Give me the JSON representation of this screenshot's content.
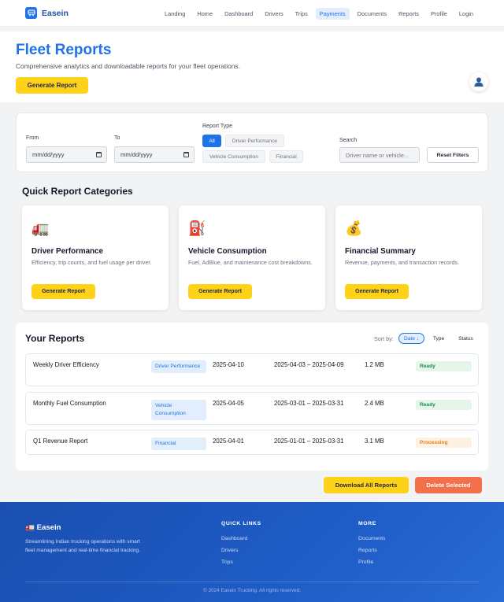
{
  "nav": {
    "brand": "Easein",
    "links": [
      "Landing",
      "Home",
      "Dashboard",
      "Drivers",
      "Trips",
      "Payments",
      "Documents",
      "Reports",
      "Profile",
      "Login"
    ],
    "active": "Payments"
  },
  "hero": {
    "title": "Fleet Reports",
    "subtitle": "Comprehensive analytics and downloadable reports for your fleet operations.",
    "button": "Generate Report"
  },
  "filters": {
    "from_label": "From",
    "to_label": "To",
    "date_placeholder": "mm/dd/yyyy",
    "report_type_label": "Report Type",
    "types": [
      "All",
      "Driver Performance",
      "Vehicle Consumption",
      "Financial"
    ],
    "selected_type": "All",
    "search_label": "Search",
    "search_placeholder": "Driver name or vehicle...",
    "reset_button": "Reset Filters"
  },
  "quick": {
    "title": "Quick Report Categories",
    "cards": [
      {
        "icon": "truck-icon",
        "glyph": "🚛",
        "title": "Driver Performance",
        "desc": "Efficiency, trip counts, and fuel usage per driver.",
        "button": "Generate Report"
      },
      {
        "icon": "fuel-pump-icon",
        "glyph": "⛽",
        "title": "Vehicle Consumption",
        "desc": "Fuel, AdBlue, and maintenance cost breakdowns.",
        "button": "Generate Report"
      },
      {
        "icon": "money-bag-icon",
        "glyph": "💰",
        "title": "Financial Summary",
        "desc": "Revenue, payments, and transaction records.",
        "button": "Generate Report"
      }
    ]
  },
  "reports": {
    "title": "Your Reports",
    "sort_label": "Sort by:",
    "sort_options": [
      "Date ↓",
      "Type",
      "Status"
    ],
    "rows": [
      {
        "name": "Weekly Driver Efficiency",
        "category": "Driver Performance",
        "date": "2025-04-10",
        "range": "2025-04-03 – 2025-04-09",
        "size": "1.2 MB",
        "status": "Ready"
      },
      {
        "name": "Monthly Fuel Consumption",
        "category": "Vehicle Consumption",
        "date": "2025-04-05",
        "range": "2025-03-01 – 2025-03-31",
        "size": "2.4 MB",
        "status": "Ready"
      },
      {
        "name": "Q1 Revenue Report",
        "category": "Financial",
        "date": "2025-04-01",
        "range": "2025-01-01 – 2025-03-31",
        "size": "3.1 MB",
        "status": "Processing"
      }
    ]
  },
  "actions": {
    "download_all": "Download All Reports",
    "delete_selected": "Delete Selected"
  },
  "footer": {
    "brand": "🚛 Easein",
    "desc": "Streamlining Indian trucking operations with smart fleet management and real-time financial tracking.",
    "quick_links_title": "QUICK LINKS",
    "quick_links": [
      "Dashboard",
      "Drivers",
      "Trips"
    ],
    "more_title": "MORE",
    "more_links": [
      "Documents",
      "Reports",
      "Profile"
    ],
    "copyright": "© 2024 Easein Trucking. All rights reserved."
  },
  "colors": {
    "primary": "#1e73e8",
    "accent_yellow": "#ffd21a",
    "danger": "#f4704b",
    "ready_green": "#1f8f43",
    "processing_orange": "#e3821a"
  }
}
